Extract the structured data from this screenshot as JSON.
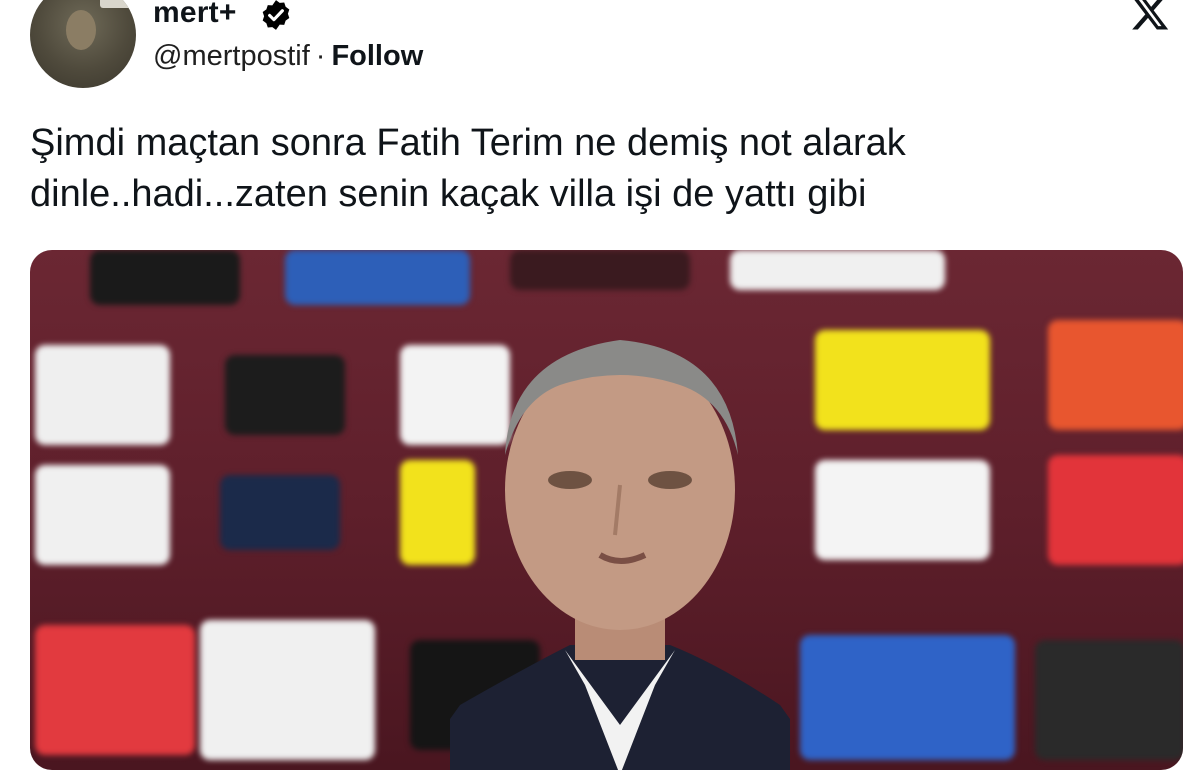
{
  "header": {
    "display_name": "mert+",
    "handle": "@mertpostif",
    "separator": "·",
    "follow_label": "Follow"
  },
  "icons": {
    "verified": "verified-badge-icon",
    "platform": "x-logo-icon"
  },
  "tweet": {
    "line1": "Şimdi maçtan sonra Fatih Terim ne demiş not alarak",
    "line2": "dinle..hadi...zaten senin kaçak villa işi de yattı gibi"
  },
  "media": {
    "description_alt": "photo",
    "background_color": "#5e1f2b"
  },
  "colors": {
    "text": "#0f1419",
    "verified": "#000000"
  }
}
